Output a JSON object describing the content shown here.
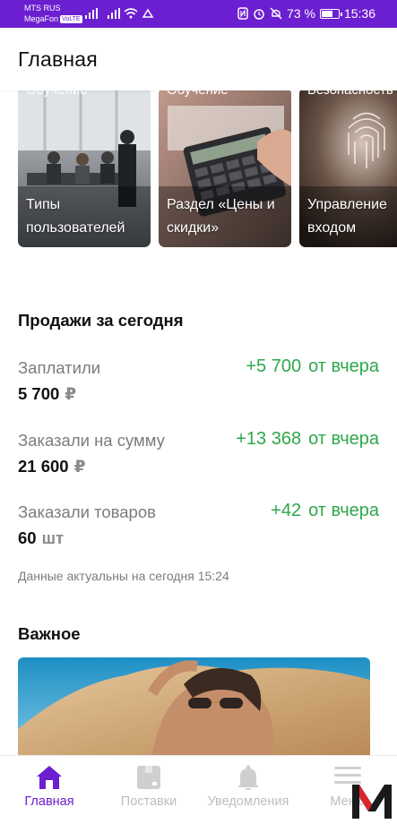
{
  "status_bar": {
    "carrier1": "MTS RUS",
    "carrier2": "MegaFon",
    "volte": "VoLTE",
    "battery": "73 %",
    "battery_level": 0.73,
    "time": "15:36"
  },
  "header": {
    "title": "Главная"
  },
  "cards": [
    {
      "tag": "Обучение",
      "title": "Типы пользователей"
    },
    {
      "tag": "Обучение",
      "title": "Раздел «Цены и скидки»"
    },
    {
      "tag": "Безопасность",
      "title": "Управление входом"
    }
  ],
  "sales": {
    "title": "Продажи за сегодня",
    "rows": [
      {
        "label": "Заплатили",
        "value": "5 700",
        "unit": "₽",
        "delta": "+5 700",
        "since": "от вчера"
      },
      {
        "label": "Заказали на сумму",
        "value": "21 600",
        "unit": "₽",
        "delta": "+13 368",
        "since": "от вчера"
      },
      {
        "label": "Заказали товаров",
        "value": "60",
        "unit": "шт",
        "delta": "+42",
        "since": "от вчера"
      }
    ],
    "updated": "Данные актуальны на сегодня 15:24"
  },
  "important": {
    "title": "Важное"
  },
  "nav": [
    {
      "label": "Главная",
      "icon": "home-icon"
    },
    {
      "label": "Поставки",
      "icon": "box-icon"
    },
    {
      "label": "Уведомления",
      "icon": "bell-icon"
    },
    {
      "label": "Меню",
      "icon": "menu-icon"
    }
  ],
  "colors": {
    "accent": "#6b1fd0",
    "positive": "#2ea84a",
    "muted": "#7c7c7c"
  }
}
